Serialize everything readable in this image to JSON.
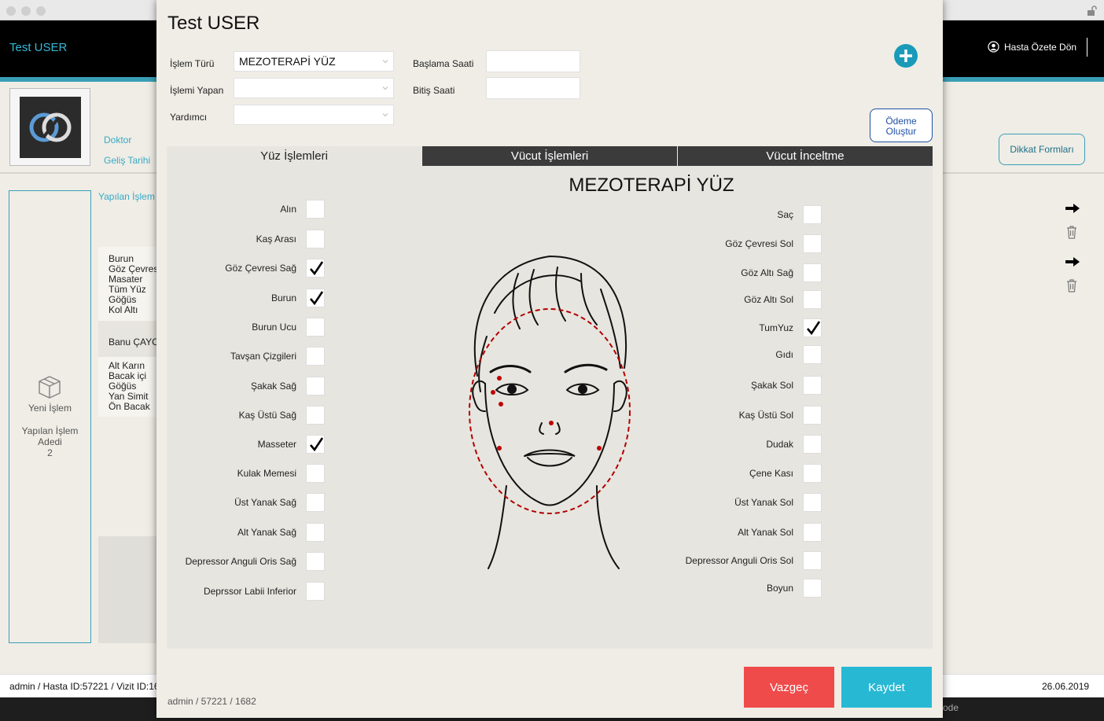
{
  "background": {
    "app_title": "Test USER",
    "back_button": "Hasta Özete Dön",
    "doktor_label": "Doktor",
    "gelis_label": "Geliş Tarihi",
    "yapilan_islemler_label": "Yapılan İşlem",
    "list1": [
      "Burun",
      "Göz Çevres",
      "Masater",
      "Tüm Yüz",
      "Göğüs",
      "Kol Altı"
    ],
    "person": "Banu ÇAYC",
    "list2": [
      "Alt Karın",
      "Bacak içi",
      "Göğüs",
      "Yan Simit",
      "Ön Bacak"
    ],
    "new_procedure": "Yeni İşlem",
    "count_label_1": "Yapılan İşlem",
    "count_label_2": "Adedi",
    "count_value": "2",
    "dikkat_button": "Dikkat Formları",
    "footer_left": "admin / Hasta ID:57221 / Vizit ID:16",
    "footer_date": "26.06.2019",
    "dock_text": "ode",
    "accent_color": "#3a9fb6"
  },
  "modal": {
    "title": "Test USER",
    "islem_turu_label": "İşlem Türü",
    "islem_turu_value": "MEZOTERAPİ YÜZ",
    "islemi_yapan_label": "İşlemi Yapan",
    "islemi_yapan_value": "",
    "yardimci_label": "Yardımcı",
    "yardimci_value": "",
    "baslama_label": "Başlama Saati",
    "baslama_value": "",
    "bitis_label": "Bitiş Saati",
    "bitis_value": "",
    "odeme_line1": "Ödeme",
    "odeme_line2": "Oluştur",
    "tabs": [
      "Yüz İşlemleri",
      "Vücut İşlemleri",
      "Vücut İnceltme"
    ],
    "active_tab": "Yüz İşlemleri",
    "panel_title": "MEZOTERAPİ YÜZ",
    "left_items": [
      {
        "label": "Alın",
        "checked": false
      },
      {
        "label": "Kaş Arası",
        "checked": false
      },
      {
        "label": "Göz Çevresi Sağ",
        "checked": true
      },
      {
        "label": "Burun",
        "checked": true
      },
      {
        "label": "Burun Ucu",
        "checked": false
      },
      {
        "label": "Tavşan Çizgileri",
        "checked": false
      },
      {
        "label": "Şakak Sağ",
        "checked": false
      },
      {
        "label": "Kaş Üstü Sağ",
        "checked": false
      },
      {
        "label": "Masseter",
        "checked": true
      },
      {
        "label": "Kulak Memesi",
        "checked": false
      },
      {
        "label": "Üst Yanak Sağ",
        "checked": false
      },
      {
        "label": "Alt Yanak Sağ",
        "checked": false
      },
      {
        "label": "Depressor Anguli Oris Sağ",
        "checked": false
      },
      {
        "label": "Deprssor Labii Inferior",
        "checked": false
      }
    ],
    "right_items": [
      {
        "label": "Saç",
        "checked": false
      },
      {
        "label": "Göz Çevresi Sol",
        "checked": false
      },
      {
        "label": "Göz Altı Sağ",
        "checked": false
      },
      {
        "label": "Göz Altı Sol",
        "checked": false
      },
      {
        "label": "TumYuz",
        "checked": true
      },
      {
        "label": "Gıdı",
        "checked": false
      },
      {
        "label": "Şakak Sol",
        "checked": false
      },
      {
        "label": "Kaş Üstü Sol",
        "checked": false
      },
      {
        "label": "Dudak",
        "checked": false
      },
      {
        "label": "Çene Kası",
        "checked": false
      },
      {
        "label": "Üst Yanak Sol",
        "checked": false
      },
      {
        "label": "Alt Yanak Sol",
        "checked": false
      },
      {
        "label": "Depressor Anguli Oris Sol",
        "checked": false
      },
      {
        "label": "Boyun",
        "checked": false
      }
    ],
    "cancel_button": "Vazgeç",
    "save_button": "Kaydet",
    "footer": "admin / 57221 / 1682",
    "cancel_color": "#f04b4b",
    "save_color": "#27b8d4"
  }
}
